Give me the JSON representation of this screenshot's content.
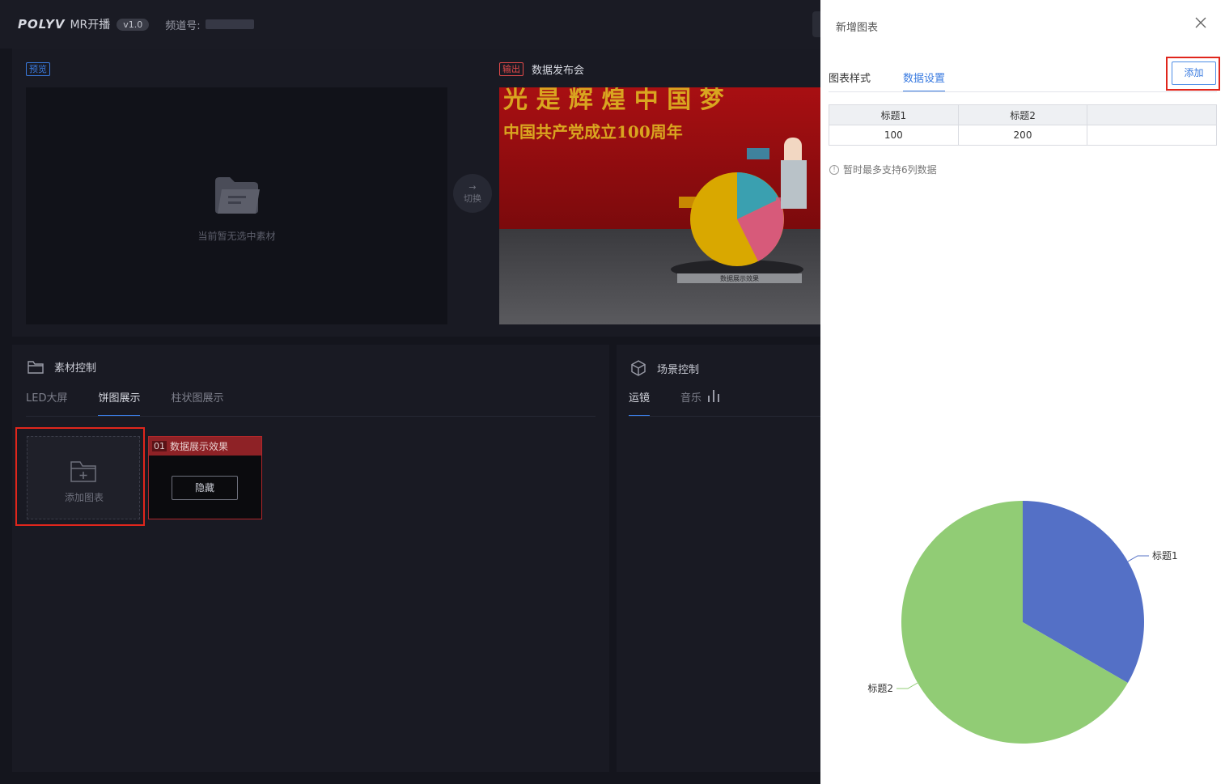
{
  "header": {
    "logo": "POLYV",
    "app_name": "MR开播",
    "version": "v1.0",
    "channel_label": "频道号:"
  },
  "preview": {
    "tag_preview": "预览",
    "empty_text": "当前暂无选中素材",
    "switch_label": "切换",
    "tag_output": "输出",
    "output_title": "数据发布会",
    "output_banner_line1": "光 是  辉 煌 中 国 梦",
    "output_banner_line2": "中国共产党成立100周年",
    "output_stage_label": "数据展示效果"
  },
  "material": {
    "title": "素材控制",
    "tabs": [
      {
        "label": "LED大屏"
      },
      {
        "label": "饼图展示"
      },
      {
        "label": "柱状图展示"
      }
    ],
    "add_chart_label": "添加图表",
    "item": {
      "num": "01",
      "title": "数据展示效果",
      "hide_label": "隐藏"
    }
  },
  "scene": {
    "title": "场景控制",
    "tabs": [
      {
        "label": "运镜"
      },
      {
        "label": "音乐"
      }
    ]
  },
  "drawer": {
    "title": "新增图表",
    "tabs": [
      {
        "label": "图表样式"
      },
      {
        "label": "数据设置"
      }
    ],
    "add_label": "添加",
    "table": {
      "headers": [
        "标题1",
        "标题2",
        ""
      ],
      "values": [
        "100",
        "200",
        ""
      ]
    },
    "hint": "暂时最多支持6列数据",
    "colors": {
      "accent": "#3a7be0",
      "highlight": "#e0261c"
    }
  },
  "chart_data": {
    "type": "pie",
    "categories": [
      "标题1",
      "标题2"
    ],
    "values": [
      100,
      200
    ],
    "colors": [
      "#5470c6",
      "#91cc75"
    ]
  }
}
